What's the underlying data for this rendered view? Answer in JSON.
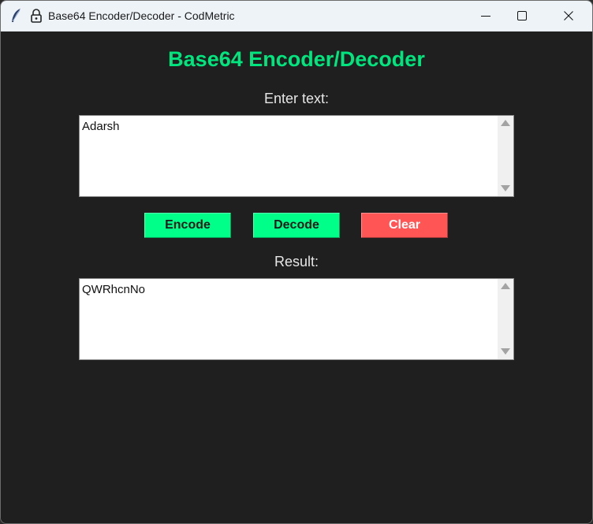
{
  "window": {
    "title": "Base64 Encoder/Decoder - CodMetric"
  },
  "app": {
    "heading": "Base64 Encoder/Decoder",
    "input_label": "Enter text:",
    "input_value": "Adarsh",
    "result_label": "Result:",
    "result_value": "QWRhcnNo"
  },
  "buttons": {
    "encode": "Encode",
    "decode": "Decode",
    "clear": "Clear"
  },
  "colors": {
    "background": "#1f1f1f",
    "accent": "#00e67e",
    "action_button": "#00ff88",
    "clear_button": "#ff5555",
    "label_text": "#e6e6e6"
  },
  "icons": [
    "feather-icon",
    "lock-icon",
    "minimize-icon",
    "maximize-icon",
    "close-icon",
    "scroll-up-icon",
    "scroll-down-icon"
  ]
}
